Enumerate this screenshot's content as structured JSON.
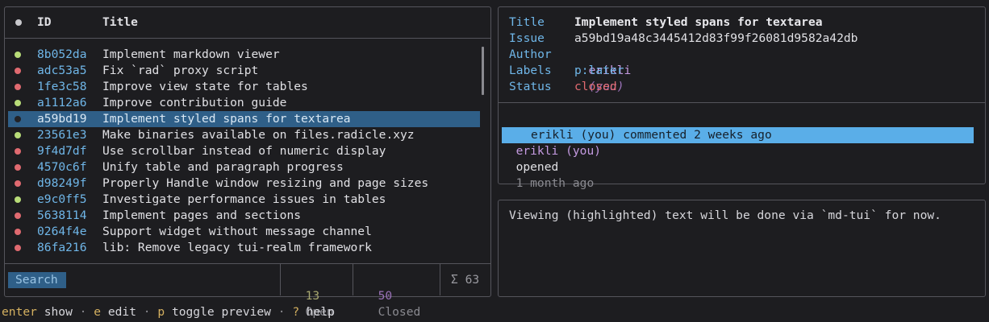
{
  "list": {
    "header": {
      "id": "ID",
      "title": "Title"
    },
    "rows": [
      {
        "id": "8b052da",
        "title": "Implement markdown viewer",
        "state": "open"
      },
      {
        "id": "adc53a5",
        "title": "Fix `rad` proxy script",
        "state": "closed"
      },
      {
        "id": "1fe3c58",
        "title": "Improve view state for tables",
        "state": "closed"
      },
      {
        "id": "a1112a6",
        "title": "Improve contribution guide",
        "state": "open"
      },
      {
        "id": "a59bd19",
        "title": "Implement styled spans for textarea",
        "state": "closed",
        "selected": true
      },
      {
        "id": "23561e3",
        "title": "Make binaries available on files.radicle.xyz",
        "state": "open"
      },
      {
        "id": "9f4d7df",
        "title": "Use scrollbar instead of numeric display",
        "state": "closed"
      },
      {
        "id": "4570c6f",
        "title": "Unify table and paragraph progress",
        "state": "closed"
      },
      {
        "id": "d98249f",
        "title": "Properly Handle window resizing and page sizes",
        "state": "closed"
      },
      {
        "id": "e9c0ff5",
        "title": "Investigate performance issues in tables",
        "state": "open"
      },
      {
        "id": "5638114",
        "title": "Implement pages and sections",
        "state": "closed"
      },
      {
        "id": "0264f4e",
        "title": "Support widget without message channel",
        "state": "closed"
      },
      {
        "id": "86fa216",
        "title": "lib: Remove legacy tui-realm framework",
        "state": "closed"
      }
    ],
    "footer": {
      "search_label": "Search",
      "open_count": "13",
      "open_label": "Open",
      "closed_count": "50",
      "closed_label": "Closed",
      "total": "Σ 63"
    }
  },
  "detail": {
    "title_label": "Title",
    "title_value": "Implement styled spans for textarea",
    "issue_label": "Issue",
    "issue_value": "a59bd19a48c3445412d83f99f26081d9582a42db",
    "author_label": "Author",
    "author_value": "erikli",
    "author_you": "(you)",
    "labels_label": "Labels",
    "labels_value": "p:later",
    "status_label": "Status",
    "status_value": "closed"
  },
  "timeline": {
    "arrow": "▼",
    "opened_author": "erikli (you)",
    "opened_verb": "opened",
    "opened_time": "1 month ago",
    "comment_line": "erikli (you) commented 2 weeks ago"
  },
  "preview": {
    "text": "Viewing (highlighted) text will be done via `md-tui` for now."
  },
  "shortcuts": [
    {
      "key": "enter",
      "action": "show"
    },
    {
      "key": "e",
      "action": "edit"
    },
    {
      "key": "p",
      "action": "toggle preview"
    },
    {
      "key": "?",
      "action": "help"
    }
  ],
  "colors": {
    "open": "#b8dc78",
    "closed": "#e06a70",
    "selection": "#2f5f88",
    "accent": "#6fb6e8"
  }
}
